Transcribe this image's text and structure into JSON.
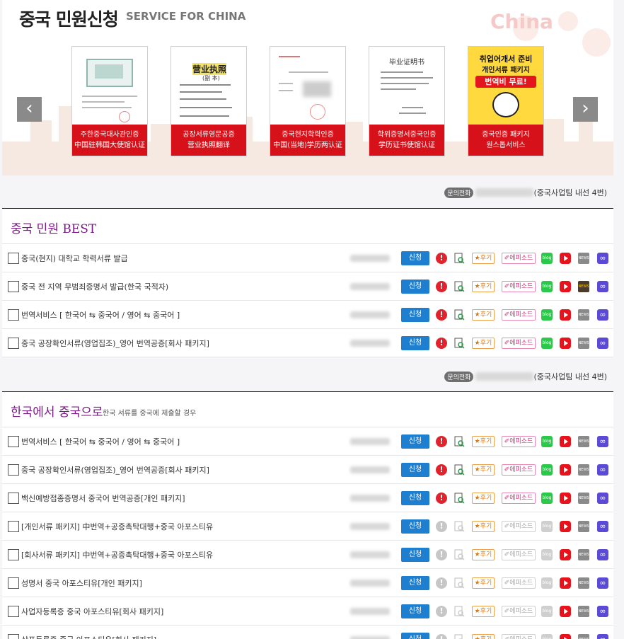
{
  "header": {
    "title": "중국 민원신청",
    "subtitle": "SERVICE FOR CHINA",
    "watermark": "China"
  },
  "carousel": {
    "prev_icon": "chevron-left-icon",
    "next_icon": "chevron-right-icon",
    "prev_label": "‹",
    "next_label": "›",
    "cards": [
      {
        "line1": "주한중국대사관인증",
        "line2": "中国驻韩国大使馆认证"
      },
      {
        "line1": "공장서류영문공증",
        "line2": "营业执照翻译",
        "doc_title": "营业执照",
        "doc_sub": "(副 本)"
      },
      {
        "line1": "중국현지학력인증",
        "line2": "中国(当地)学历两认证"
      },
      {
        "line1": "학위증명서중국인증",
        "line2": "学历证书使馆认证",
        "doc_title": "毕业证明书"
      },
      {
        "line1": "중국인증 패키지",
        "line2": "원스톱서비스",
        "promo1": "취업어개서 준비",
        "promo2": "개인서류 패키지",
        "promo3": "번역비 무료!"
      }
    ]
  },
  "contact": {
    "badge": "문의전화",
    "team": "(중국사업팀 내선 4번)"
  },
  "sections": [
    {
      "title": "중국 민원 BEST",
      "desc": "",
      "rows": [
        {
          "title": "중국(현지) 대학교 학력서류 발급",
          "apply": "신청",
          "review": "★후기",
          "episode": "✐에피소드",
          "active": true,
          "news": false
        },
        {
          "title": "중국 전 지역 무범죄증명서 발급(한국 국적자)",
          "apply": "신청",
          "review": "★후기",
          "episode": "✐에피소드",
          "active": true,
          "news": true
        },
        {
          "title": "번역서비스 [ 한국어 ⇆ 중국어 / 영어 ⇆ 중국어 ]",
          "apply": "신청",
          "review": "★후기",
          "episode": "✐에피소드",
          "active": true,
          "news": false
        },
        {
          "title": "중국 공장확인서류(영업집조)_영어 번역공증[회사 패키지]",
          "apply": "신청",
          "review": "★후기",
          "episode": "✐에피소드",
          "active": true,
          "news": false
        }
      ]
    },
    {
      "title": "한국에서 중국으로",
      "desc": "한국 서류를 중국에 제출할 경우",
      "rows": [
        {
          "title": "번역서비스 [ 한국어 ⇆ 중국어 / 영어 ⇆ 중국어 ]",
          "apply": "신청",
          "review": "★후기",
          "episode": "✐에피소드",
          "active": true,
          "news": false
        },
        {
          "title": "중국 공장확인서류(영업집조)_영어 번역공증[회사 패키지]",
          "apply": "신청",
          "review": "★후기",
          "episode": "✐에피소드",
          "active": true,
          "news": false
        },
        {
          "title": "백신예방접종증명서 중국어 번역공증[개인 패키지]",
          "apply": "신청",
          "review": "★후기",
          "episode": "✐에피소드",
          "active": true,
          "news": false
        },
        {
          "title": "[개인서류 패키지] 中번역+공증촉탁대행+중국 아포스티유",
          "apply": "신청",
          "review": "★후기",
          "episode": "✐에피소드",
          "active": false,
          "news": false
        },
        {
          "title": "[회사서류 패키지] 中번역+공증촉탁대행+중국 아포스티유",
          "apply": "신청",
          "review": "★후기",
          "episode": "✐에피소드",
          "active": false,
          "news": false
        },
        {
          "title": "성명서 중국 아포스티유[개인 패키지]",
          "apply": "신청",
          "review": "★후기",
          "episode": "✐에피소드",
          "active": false,
          "news": false
        },
        {
          "title": "사업자등록증 중국 아포스티유[회사 패키지]",
          "apply": "신청",
          "review": "★후기",
          "episode": "✐에피소드",
          "active": false,
          "news": false
        },
        {
          "title": "상표등록증 중국 아포스티유[회사 패키지]",
          "apply": "신청",
          "review": "★후기",
          "episode": "✐에피소드",
          "active": false,
          "news": false
        }
      ]
    }
  ],
  "icons": {
    "alert": "alert-icon",
    "doc_search": "document-search-icon",
    "blog": "blog-icon",
    "youtube": "youtube-icon",
    "news": "news-icon",
    "link": "link-icon",
    "alert_glyph": "!",
    "blog_glyph": "blog",
    "news_glyph": "NEWS",
    "link_glyph": "∞"
  },
  "colors": {
    "accent_red": "#d6111a",
    "apply_blue": "#1e7fd0",
    "section_title": "#7a1b86"
  }
}
